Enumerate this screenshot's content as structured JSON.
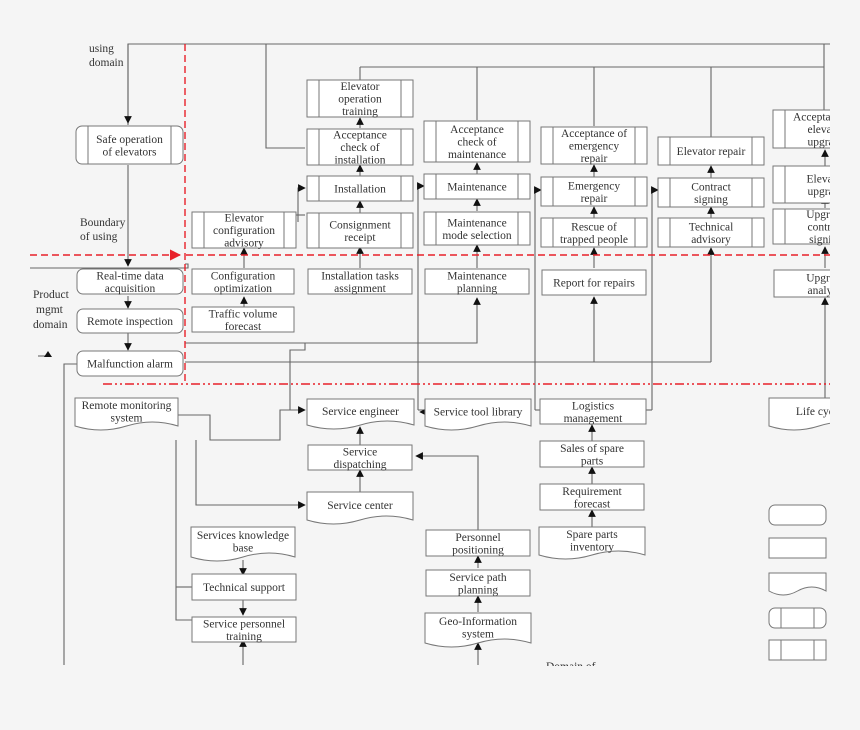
{
  "labels": {
    "using_domain": [
      "using",
      "domain"
    ],
    "boundary_of_using": [
      "Boundary",
      "of using"
    ],
    "product_mgmt_domain": [
      "Product",
      "mgmt",
      "domain"
    ],
    "bottom_cut": "Domain of"
  },
  "using_domain": {
    "safe_operation": [
      "Safe operation",
      "of elevators"
    ]
  },
  "product_domain": {
    "realtime_data": [
      "Real-time data",
      "acquisition"
    ],
    "remote_inspection": [
      "Remote inspection"
    ],
    "malfunction_alarm": [
      "Malfunction alarm"
    ]
  },
  "columns": [
    {
      "name": "configuration",
      "process": [
        [
          "Elevator",
          "configuration",
          "advisory"
        ]
      ],
      "planning": [
        [
          "Configuration",
          "optimization"
        ],
        [
          "Traffic volume",
          "forecast"
        ]
      ]
    },
    {
      "name": "installation",
      "process": [
        [
          "Elevator",
          "operation",
          "training"
        ],
        [
          "Acceptance",
          "check of",
          "installation"
        ],
        [
          "Installation"
        ],
        [
          "Consignment",
          "receipt"
        ]
      ],
      "planning": [
        [
          "Installation tasks",
          "assignment"
        ]
      ]
    },
    {
      "name": "maintenance",
      "process": [
        [
          "Acceptance",
          "check of",
          "maintenance"
        ],
        [
          "Maintenance"
        ],
        [
          "Maintenance",
          "mode selection"
        ]
      ],
      "planning": [
        [
          "Maintenance",
          "planning"
        ]
      ]
    },
    {
      "name": "emergency",
      "process": [
        [
          "Acceptance  of",
          "emergency",
          "repair"
        ],
        [
          "Emergency",
          "repair"
        ],
        [
          "Rescue of",
          "trapped people"
        ]
      ],
      "planning": [
        [
          "Report for repairs"
        ]
      ]
    },
    {
      "name": "repair",
      "process": [
        [
          "Elevator repair"
        ],
        [
          "Contract",
          "signing"
        ],
        [
          "Technical",
          "advisory"
        ]
      ],
      "planning": []
    },
    {
      "name": "upgrade",
      "process": [
        [
          "Acceptance of",
          "elevator",
          "upgrade"
        ],
        [
          "Elevator",
          "upgrade"
        ],
        [
          "Upgrade",
          "contract",
          "signing"
        ]
      ],
      "planning": [
        [
          "Upgrade",
          "analysis"
        ]
      ]
    }
  ],
  "support": {
    "remote_monitoring": [
      "Remote monitoring",
      "system"
    ],
    "service_engineer": [
      "Service engineer"
    ],
    "service_tool_library": [
      "Service tool library"
    ],
    "logistics": [
      "Logistics",
      "management"
    ],
    "life_cycle": [
      "Life cycle"
    ],
    "service_dispatching": [
      "Service",
      "dispatching"
    ],
    "sales_spare_parts": [
      "Sales of spare",
      "parts"
    ],
    "service_center": [
      "Service center"
    ],
    "requirement_forecast": [
      "Requirement",
      "forecast"
    ],
    "services_knowledge": [
      "Services knowledge",
      "base"
    ],
    "personnel_positioning": [
      "Personnel",
      "positioning"
    ],
    "spare_parts_inventory": [
      "Spare parts",
      "inventory"
    ],
    "technical_support": [
      "Technical support"
    ],
    "service_path": [
      "Service path",
      "planning"
    ],
    "service_personnel_training": [
      "Service personnel",
      "training"
    ],
    "geo_information": [
      "Geo-Information",
      "system"
    ]
  },
  "legend": [
    "rounded-process",
    "process",
    "document",
    "rounded-subprocess",
    "subprocess"
  ]
}
